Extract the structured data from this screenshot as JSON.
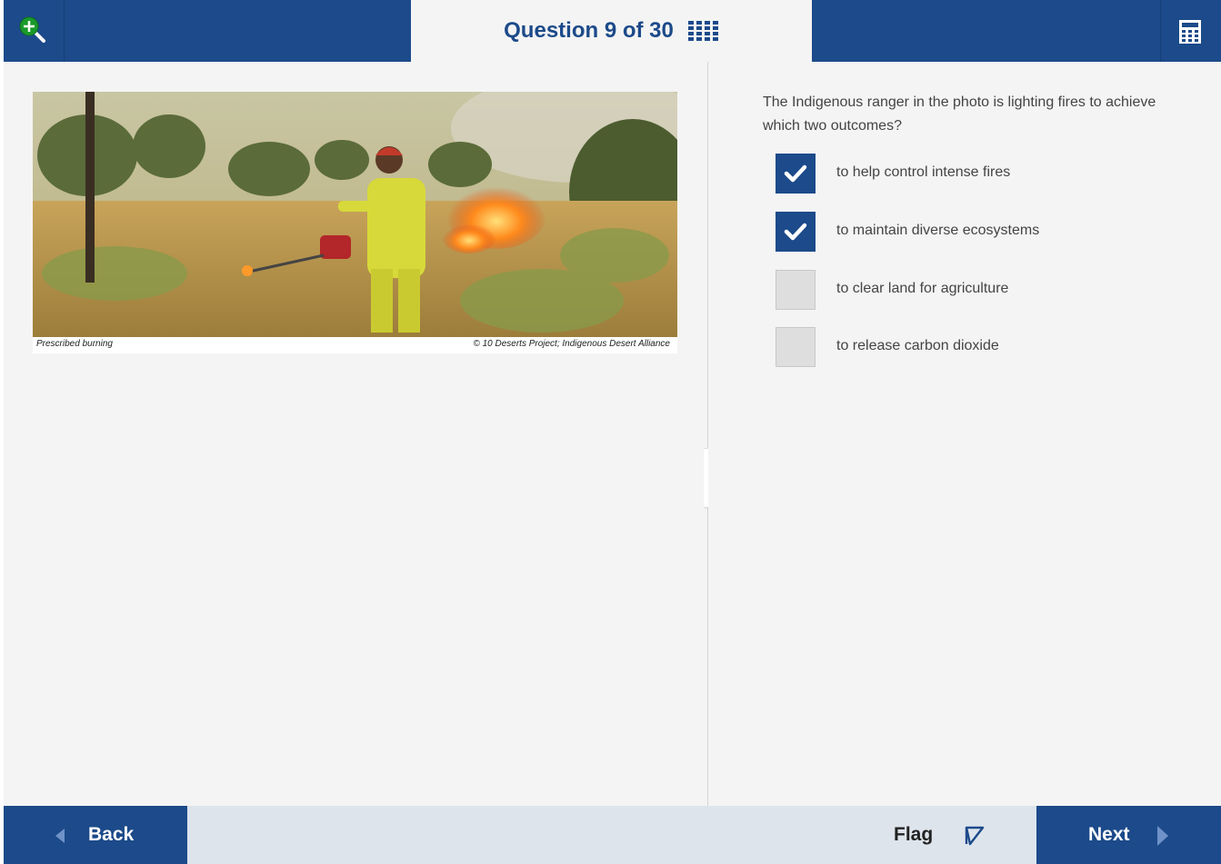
{
  "header": {
    "question_counter": "Question 9 of 30",
    "zoom_icon": "zoom-in-magnifier-icon",
    "grid_icon": "question-grid-icon",
    "calculator_icon": "calculator-icon"
  },
  "stimulus": {
    "image_description_icon": "photo-ranger-prescribed-burning",
    "caption_left": "Prescribed burning",
    "caption_right": "© 10 Deserts Project; Indigenous Desert Alliance"
  },
  "question": {
    "prompt": "The Indigenous ranger in the photo is lighting fires to achieve which two outcomes?",
    "options": [
      {
        "label": "to help control intense fires",
        "checked": true
      },
      {
        "label": "to maintain diverse ecosystems",
        "checked": true
      },
      {
        "label": "to clear land for agriculture",
        "checked": false
      },
      {
        "label": "to release carbon dioxide",
        "checked": false
      }
    ]
  },
  "footer": {
    "back_label": "Back",
    "flag_label": "Flag",
    "next_label": "Next"
  },
  "colors": {
    "primary": "#1c4a8a",
    "panel_bg": "#f4f4f4",
    "footer_bg": "#dde4ec",
    "zoom_green": "#1a9a2a"
  }
}
